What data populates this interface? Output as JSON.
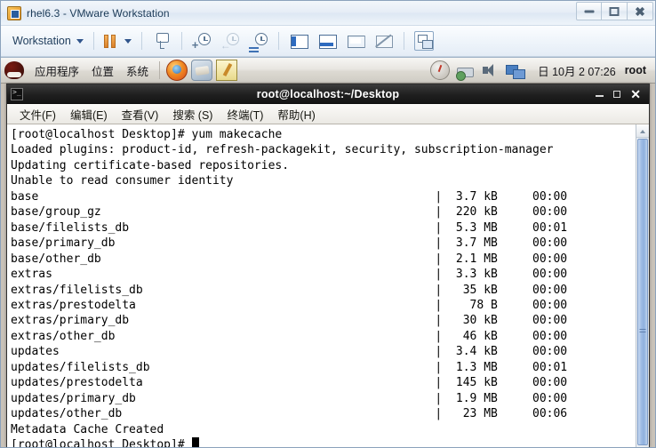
{
  "vmware": {
    "title": "rhel6.3 - VMware Workstation",
    "app_icon": "vmware-vm-icon",
    "window_controls": {
      "minimize": "minimize-icon",
      "restore": "restore-icon",
      "close": "close-icon"
    },
    "toolbar": {
      "workstation_label": "Workstation",
      "items": [
        {
          "name": "suspend-button",
          "icon": "pause-icon"
        },
        {
          "name": "power-dropdown",
          "icon": "chevron-down-icon"
        },
        {
          "name": "send-ctrl-alt-del-button",
          "icon": "machine-icon"
        },
        {
          "name": "take-snapshot-button",
          "icon": "clock-plus-icon"
        },
        {
          "name": "revert-snapshot-button",
          "icon": "clock-revert-icon"
        },
        {
          "name": "manage-snapshots-button",
          "icon": "clock-manage-icon"
        },
        {
          "name": "show-sidebar-button",
          "icon": "sidebar-icon"
        },
        {
          "name": "show-thumbnail-bar-button",
          "icon": "thumbnail-bar-icon"
        },
        {
          "name": "enter-fullscreen-button",
          "icon": "fullscreen-icon"
        },
        {
          "name": "unity-mode-button",
          "icon": "unity-icon"
        },
        {
          "name": "console-view-button",
          "icon": "console-icon"
        }
      ]
    }
  },
  "gnome_panel": {
    "logo": "redhat-logo-icon",
    "menus": [
      {
        "label": "应用程序",
        "name": "menu-applications"
      },
      {
        "label": "位置",
        "name": "menu-places"
      },
      {
        "label": "系统",
        "name": "menu-system"
      }
    ],
    "launchers": [
      {
        "name": "firefox-launcher",
        "icon": "firefox-icon"
      },
      {
        "name": "help-launcher",
        "icon": "help-book-icon"
      },
      {
        "name": "text-editor-launcher",
        "icon": "text-editor-icon"
      }
    ],
    "tray": [
      {
        "name": "update-notifier-icon",
        "icon": "update-icon"
      },
      {
        "name": "printer-icon",
        "icon": "printer-icon"
      },
      {
        "name": "volume-icon",
        "icon": "speaker-icon"
      },
      {
        "name": "network-icon",
        "icon": "network-monitor-icon"
      }
    ],
    "clock": "日 10月  2 07:26",
    "user": "root"
  },
  "terminal": {
    "title": "root@localhost:~/Desktop",
    "icon": "terminal-icon",
    "window_controls": {
      "minimize": "minimize-icon",
      "maximize": "maximize-icon",
      "close": "close-icon"
    },
    "menus": [
      {
        "label": "文件(F)",
        "name": "menu-file"
      },
      {
        "label": "编辑(E)",
        "name": "menu-edit"
      },
      {
        "label": "查看(V)",
        "name": "menu-view"
      },
      {
        "label": "搜索 (S)",
        "name": "menu-search"
      },
      {
        "label": "终端(T)",
        "name": "menu-terminal"
      },
      {
        "label": "帮助(H)",
        "name": "menu-help"
      }
    ],
    "content": {
      "prompt_command": "[root@localhost Desktop]# yum makecache",
      "lines": [
        "Loaded plugins: product-id, refresh-packagekit, security, subscription-manager",
        "Updating certificate-based repositories.",
        "Unable to read consumer identity"
      ],
      "repo_rows": [
        {
          "name": "base",
          "size": "3.7 kB",
          "time": "00:00"
        },
        {
          "name": "base/group_gz",
          "size": "220 kB",
          "time": "00:00"
        },
        {
          "name": "base/filelists_db",
          "size": "5.3 MB",
          "time": "00:01"
        },
        {
          "name": "base/primary_db",
          "size": "3.7 MB",
          "time": "00:00"
        },
        {
          "name": "base/other_db",
          "size": "2.1 MB",
          "time": "00:00"
        },
        {
          "name": "extras",
          "size": "3.3 kB",
          "time": "00:00"
        },
        {
          "name": "extras/filelists_db",
          "size": "35 kB",
          "time": "00:00"
        },
        {
          "name": "extras/prestodelta",
          "size": "78 B",
          "time": "00:00"
        },
        {
          "name": "extras/primary_db",
          "size": "30 kB",
          "time": "00:00"
        },
        {
          "name": "extras/other_db",
          "size": "46 kB",
          "time": "00:00"
        },
        {
          "name": "updates",
          "size": "3.4 kB",
          "time": "00:00"
        },
        {
          "name": "updates/filelists_db",
          "size": "1.3 MB",
          "time": "00:01"
        },
        {
          "name": "updates/prestodelta",
          "size": "145 kB",
          "time": "00:00"
        },
        {
          "name": "updates/primary_db",
          "size": "1.9 MB",
          "time": "00:00"
        },
        {
          "name": "updates/other_db",
          "size": "23 MB",
          "time": "00:06"
        }
      ],
      "final_message": "Metadata Cache Created",
      "final_prompt": "[root@localhost Desktop]# "
    }
  },
  "colors": {
    "vmware_chrome": "#e6edf6",
    "terminal_titlebar": "#1f1f1f",
    "terminal_bg": "#ffffff",
    "terminal_fg": "#000000",
    "panel_bg": "#e8e6e1",
    "scrollbar_thumb": "#9dbbe4"
  }
}
